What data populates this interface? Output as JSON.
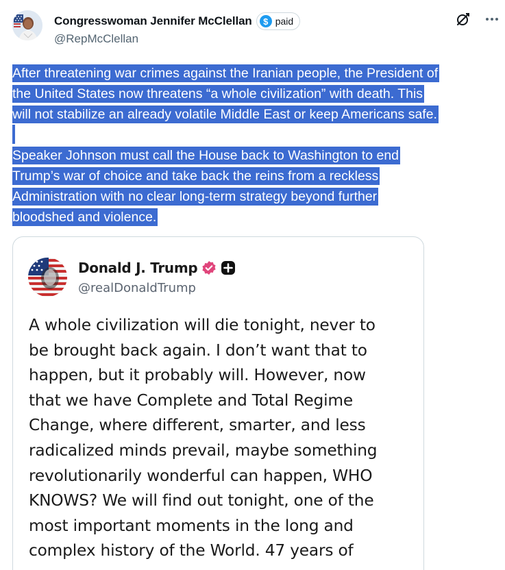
{
  "author": {
    "name": "Congresswoman Jennifer McClellan",
    "handle": "@RepMcClellan",
    "badge_label": "paid",
    "badge_symbol": "$"
  },
  "icons": {
    "grok": "grok-icon",
    "more": "more-icon"
  },
  "tweet": {
    "para1": [
      "After threatening war crimes against the Iranian people, the President of",
      "the United States now threatens “a whole civilization” with death. This",
      "will not stabilize an already volatile Middle East or keep Americans safe."
    ],
    "para2": [
      "Speaker Johnson must call the House back to Washington to end",
      "Trump’s war of choice and take back the reins from a reckless",
      "Administration with no clear long-term strategy beyond further",
      "bloodshed and violence."
    ]
  },
  "quoted": {
    "name": "Donald J. Trump",
    "handle": "@realDonaldTrump",
    "body_lines": [
      "A whole civilization will die tonight, never to",
      "be brought back again. I don’t want that to",
      "happen, but it probably will. However, now",
      "that we have Complete and Total Regime",
      "Change, where different, smarter, and less",
      "radicalized minds prevail, maybe something",
      "revolutionarily wonderful can happen, WHO",
      "KNOWS? We will find out tonight, one of the",
      "most important moments in the long and",
      "complex history of the World. 47 years of"
    ]
  },
  "colors": {
    "selection": "#3c6bd1",
    "verified_badge": "#e0457b",
    "paid_badge": "#1d9bf0"
  }
}
